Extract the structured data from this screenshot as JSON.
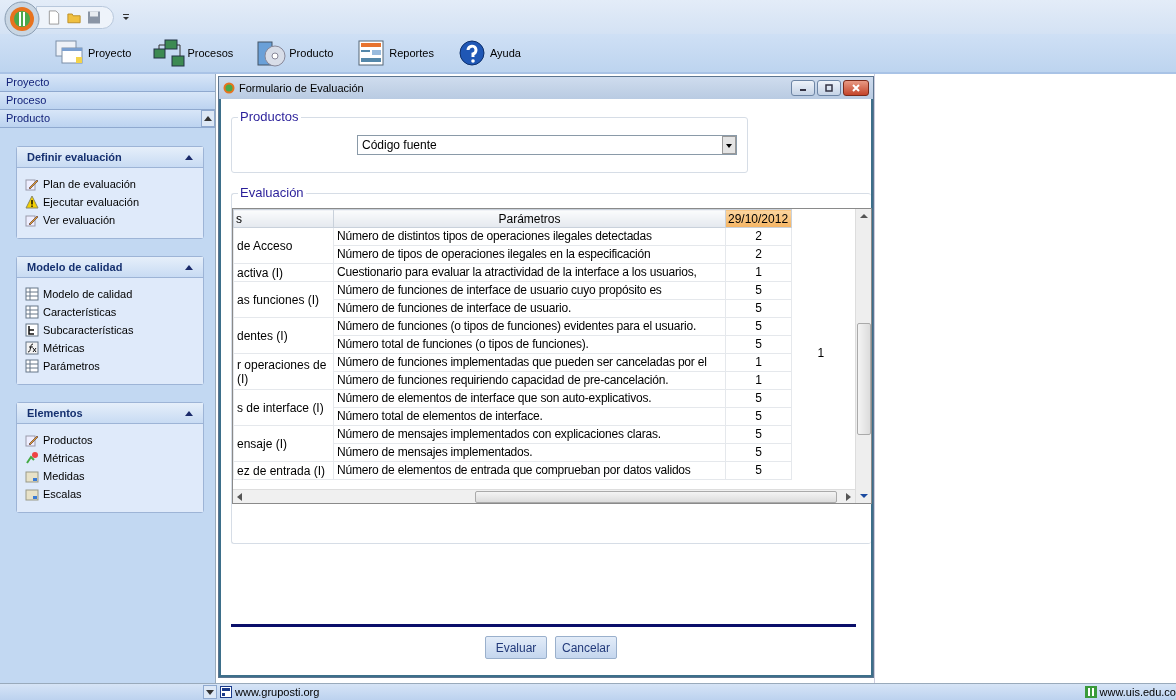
{
  "toolbar": {
    "buttons": [
      {
        "label": "Proyecto"
      },
      {
        "label": "Procesos"
      },
      {
        "label": "Producto"
      },
      {
        "label": "Reportes"
      },
      {
        "label": "Ayuda"
      }
    ]
  },
  "sidebar": {
    "nav": [
      {
        "label": "Proyecto",
        "expanded": false
      },
      {
        "label": "Proceso",
        "expanded": false
      },
      {
        "label": "Producto",
        "expanded": true
      }
    ],
    "sections": [
      {
        "title": "Definir evaluación",
        "expanded": true,
        "items": [
          {
            "label": "Plan de evaluación"
          },
          {
            "label": "Ejecutar evaluación"
          },
          {
            "label": "Ver evaluación"
          }
        ]
      },
      {
        "title": "Modelo de calidad",
        "expanded": true,
        "items": [
          {
            "label": "Modelo de calidad"
          },
          {
            "label": "Características"
          },
          {
            "label": "Subcaracterísticas"
          },
          {
            "label": "Métricas"
          },
          {
            "label": "Parámetros"
          }
        ]
      },
      {
        "title": "Elementos",
        "expanded": true,
        "items": [
          {
            "label": "Productos"
          },
          {
            "label": "Métricas"
          },
          {
            "label": "Medidas"
          },
          {
            "label": "Escalas"
          }
        ]
      }
    ]
  },
  "dialog": {
    "title": "Formulario de Evaluación",
    "products": {
      "legend": "Productos",
      "value": "Código fuente"
    },
    "evaluation": {
      "legend": "Evaluación",
      "table": {
        "columns": [
          "s",
          "Parámetros",
          "29/10/2012"
        ],
        "column_4_value": "1",
        "groups": [
          {
            "metric": "de Acceso",
            "params": [
              {
                "text": "Número de distintos tipos de operaciones ilegales detectadas",
                "value": "2"
              },
              {
                "text": "Número de tipos de operaciones ilegales en la especificación",
                "value": "2"
              }
            ]
          },
          {
            "metric": "activa (I)",
            "params": [
              {
                "text": "Cuestionario para evaluar la atractividad de la interface a los usuarios,",
                "value": "1"
              }
            ]
          },
          {
            "metric": "as funciones (I)",
            "params": [
              {
                "text": "Número de funciones  de interface de usuario cuyo propósito es",
                "value": "5"
              },
              {
                "text": "Número de funciones  de interface de usuario.",
                "value": "5"
              }
            ]
          },
          {
            "metric": "dentes (I)",
            "params": [
              {
                "text": "Número de funciones  (o tipos de funciones) evidentes para el usuario.",
                "value": "5"
              },
              {
                "text": "Número total de funciones (o tipos de funciones).",
                "value": "5"
              }
            ]
          },
          {
            "metric": "r operaciones de (I)",
            "params": [
              {
                "text": "Número de funciones implementadas que pueden ser canceladas por el",
                "value": "1"
              },
              {
                "text": "Número de funciones requiriendo capacidad de pre-cancelación.",
                "value": "1"
              }
            ]
          },
          {
            "metric": "s de interface (I)",
            "params": [
              {
                "text": "Número de elementos de interface que son auto-explicativos.",
                "value": "5"
              },
              {
                "text": "Número total de elementos de interface.",
                "value": "5"
              }
            ]
          },
          {
            "metric": "ensaje (I)",
            "params": [
              {
                "text": "Número de mensajes implementados con explicaciones claras.",
                "value": "5"
              },
              {
                "text": "Número de mensajes implementados.",
                "value": "5"
              }
            ]
          },
          {
            "metric": "ez de entrada (I)",
            "params": [
              {
                "text": "Número de elementos de entrada que comprueban por datos validos",
                "value": "5"
              }
            ]
          }
        ]
      }
    },
    "buttons": [
      "Evaluar",
      "Cancelar"
    ]
  },
  "status_bar": {
    "left": "www.gruposti.org",
    "right": "www.uis.edu.co"
  }
}
